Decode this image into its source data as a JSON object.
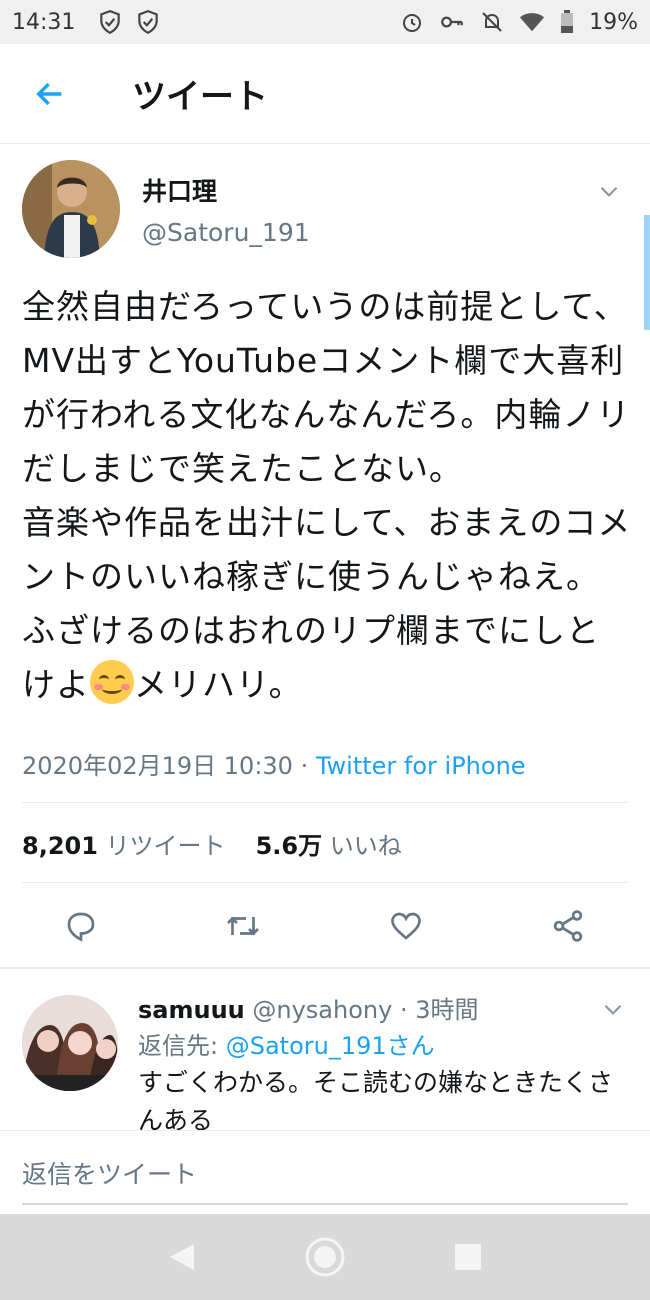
{
  "status_bar": {
    "time": "14:31",
    "battery": "19%",
    "icons_left": [
      "verified-shield-icon",
      "shield-check-icon"
    ],
    "icons_right": [
      "alarm-icon",
      "key-icon",
      "bell-off-icon",
      "wifi-icon",
      "battery-icon"
    ]
  },
  "header": {
    "title": "ツイート",
    "back_icon": "arrow-left-icon"
  },
  "tweet": {
    "author_name": "井口理",
    "author_handle": "@Satoru_191",
    "text_before_emoji": "全然自由だろっていうのは前提として、MV出すとYouTubeコメント欄で大喜利が行われる文化なんなんだろ。内輪ノリだしまじで笑えたことない。\n音楽や作品を出汁にして、おまえのコメントのいいね稼ぎに使うんじゃねえ。ふざけるのはおれのリプ欄までにしとけよ",
    "text_after_emoji": "メリハリ。",
    "emoji": "smiling-face-with-smiling-eyes",
    "timestamp": "2020年02月19日 10:30 · ",
    "source": "Twitter for iPhone",
    "retweet_count": "8,201",
    "retweet_label": "リツイート",
    "like_count": "5.6万",
    "like_label": "いいね",
    "actions": [
      "reply-icon",
      "retweet-icon",
      "like-icon",
      "share-icon"
    ]
  },
  "reply": {
    "name": "samuuu",
    "handle": "@nysahony",
    "time": " · 3時間",
    "reply_to_label": "返信先: ",
    "reply_to_mention": "@Satoru_191さん",
    "text": "すごくわかる。そこ読むの嫌なときたくさんある"
  },
  "reply_bar": {
    "placeholder": "返信をツイート"
  },
  "nav": [
    "back-triangle-icon",
    "home-circle-icon",
    "recents-square-icon"
  ],
  "colors": {
    "accent": "#1da1f2",
    "secondary_text": "#657786",
    "primary_text": "#14171a"
  }
}
